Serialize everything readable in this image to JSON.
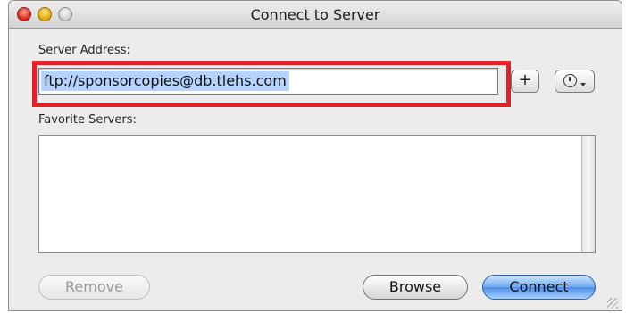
{
  "window": {
    "title": "Connect to Server"
  },
  "form": {
    "server_address_label": "Server Address:",
    "server_address_value": "ftp://sponsorcopies@db.tlehs.com",
    "add_button_label": "+",
    "favorites_label": "Favorite Servers:",
    "favorites_items": []
  },
  "buttons": {
    "remove": "Remove",
    "browse": "Browse",
    "connect": "Connect"
  },
  "icons": {
    "close": "close-icon",
    "minimize": "minimize-icon",
    "zoom": "zoom-icon",
    "recent_servers": "clock-icon",
    "resize": "resize-grip-icon"
  },
  "colors": {
    "highlight_border": "#e3202a",
    "selection": "#b5d3ff",
    "connect_button": "#4e8fe6"
  }
}
